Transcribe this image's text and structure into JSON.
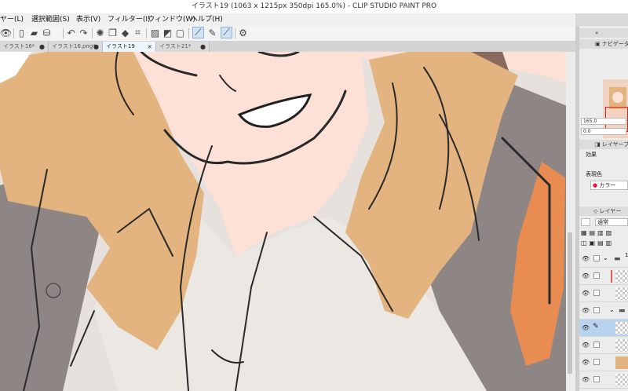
{
  "app": {
    "title": "イラスト19 (1063 x 1215px 350dpi 165.0%) - CLIP STUDIO PAINT PRO"
  },
  "menu": [
    {
      "label": "ヤー(L)"
    },
    {
      "label": "選択範囲(S)"
    },
    {
      "label": "表示(V)"
    },
    {
      "label": "フィルター(I)"
    },
    {
      "label": "ウィンドウ(W)"
    },
    {
      "label": "ヘルプ(H)"
    }
  ],
  "tabs": [
    {
      "label": "イラスト16*",
      "close": "●"
    },
    {
      "label": "イラスト16.png*",
      "close": "●"
    },
    {
      "label": "イラスト19",
      "close": "×"
    },
    {
      "label": "イラスト21*",
      "close": "●"
    }
  ],
  "panel": {
    "navigator_title": "ナビゲーター",
    "zoom_value": "165.0",
    "rotate_value": "0.0",
    "layer_property_title": "レイヤープロ",
    "effect_label": "効果",
    "expression_color_label": "表現色",
    "color_value": "カラー",
    "layer_tab": "レイヤー",
    "blend_mode": "通常",
    "layer_number": "1"
  },
  "colors": {
    "skin": "#fde0d6",
    "hair": "#e3b47f",
    "jacket": "#8e8585",
    "accent_orange": "#e98c52",
    "selection_blue": "#b8d3ee"
  }
}
